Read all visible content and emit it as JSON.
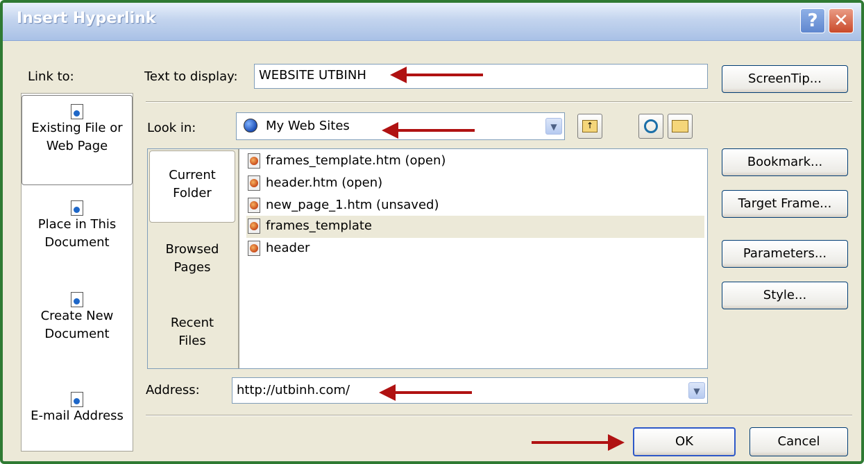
{
  "window": {
    "title": "Insert Hyperlink",
    "help_glyph": "?",
    "close_glyph": "✕"
  },
  "link_to": {
    "label": "Link to:",
    "items": [
      {
        "line1": "Existing File or",
        "line2": "Web Page",
        "icon": "web-page-icon",
        "selected": true
      },
      {
        "line1": "Place in This",
        "line2": "Document",
        "icon": "place-in-document-icon"
      },
      {
        "line1": "Create New",
        "line2": "Document",
        "icon": "new-document-icon"
      },
      {
        "line1": "E-mail Address",
        "line2": "",
        "icon": "email-icon"
      }
    ]
  },
  "text_to_display": {
    "label": "Text to display:",
    "value": "WEBSITE UTBINH"
  },
  "look_in": {
    "label": "Look in:",
    "value": "My Web Sites",
    "icon": "globe-icon",
    "dropdown_glyph": "▼"
  },
  "toolbar": {
    "up_folder_icon": "up-folder-icon",
    "browse_web_icon": "browse-web-icon",
    "browse_file_icon": "open-folder-icon"
  },
  "tabs": [
    {
      "line1": "Current",
      "line2": "Folder",
      "selected": true
    },
    {
      "line1": "Browsed",
      "line2": "Pages"
    },
    {
      "line1": "Recent",
      "line2": "Files"
    }
  ],
  "files": [
    {
      "name": "frames_template.htm (open)"
    },
    {
      "name": "header.htm (open)"
    },
    {
      "name": "new_page_1.htm (unsaved)"
    },
    {
      "name": "frames_template",
      "selected": true
    },
    {
      "name": "header"
    }
  ],
  "address": {
    "label": "Address:",
    "value": "http://utbinh.com/",
    "dropdown_glyph": "▼"
  },
  "buttons": {
    "screentip": "ScreenTip...",
    "bookmark": "Bookmark...",
    "target_frame": "Target Frame...",
    "parameters": "Parameters...",
    "style": "Style...",
    "ok": "OK",
    "cancel": "Cancel"
  },
  "colors": {
    "title_bar": "#a9c1e6",
    "dialog_bg": "#ece9d8",
    "arrow": "#b01212",
    "frame": "#2f7a33"
  }
}
